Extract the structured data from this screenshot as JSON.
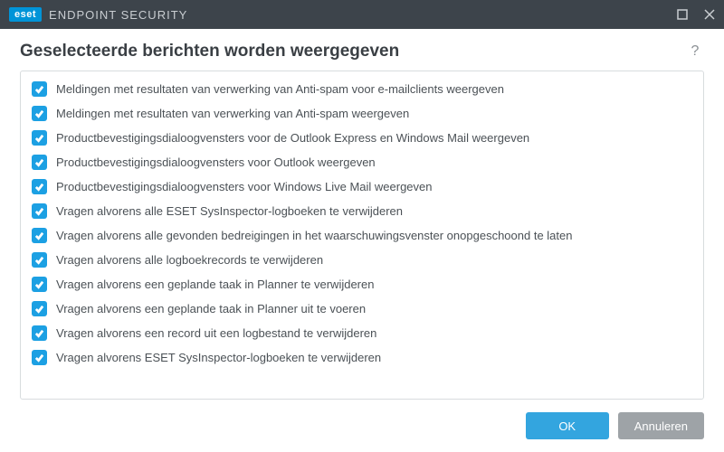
{
  "titlebar": {
    "brand_badge": "eset",
    "brand_text": "ENDPOINT SECURITY"
  },
  "header": {
    "title": "Geselecteerde berichten worden weergegeven"
  },
  "items": [
    {
      "checked": true,
      "label": "Meldingen met resultaten van verwerking van Anti-spam voor e-mailclients weergeven"
    },
    {
      "checked": true,
      "label": "Meldingen met resultaten van verwerking van Anti-spam weergeven"
    },
    {
      "checked": true,
      "label": "Productbevestigingsdialoogvensters voor de Outlook Express en Windows Mail weergeven"
    },
    {
      "checked": true,
      "label": "Productbevestigingsdialoogvensters voor Outlook weergeven"
    },
    {
      "checked": true,
      "label": "Productbevestigingsdialoogvensters voor Windows Live Mail weergeven"
    },
    {
      "checked": true,
      "label": "Vragen alvorens alle ESET SysInspector-logboeken te verwijderen"
    },
    {
      "checked": true,
      "label": "Vragen alvorens alle gevonden bedreigingen in het waarschuwingsvenster onopgeschoond te laten"
    },
    {
      "checked": true,
      "label": "Vragen alvorens alle logboekrecords te verwijderen"
    },
    {
      "checked": true,
      "label": "Vragen alvorens een geplande taak in Planner te verwijderen"
    },
    {
      "checked": true,
      "label": "Vragen alvorens een geplande taak in Planner uit te voeren"
    },
    {
      "checked": true,
      "label": "Vragen alvorens een record uit een logbestand te verwijderen"
    },
    {
      "checked": true,
      "label": "Vragen alvorens ESET SysInspector-logboeken te verwijderen"
    }
  ],
  "buttons": {
    "ok": "OK",
    "cancel": "Annuleren"
  }
}
